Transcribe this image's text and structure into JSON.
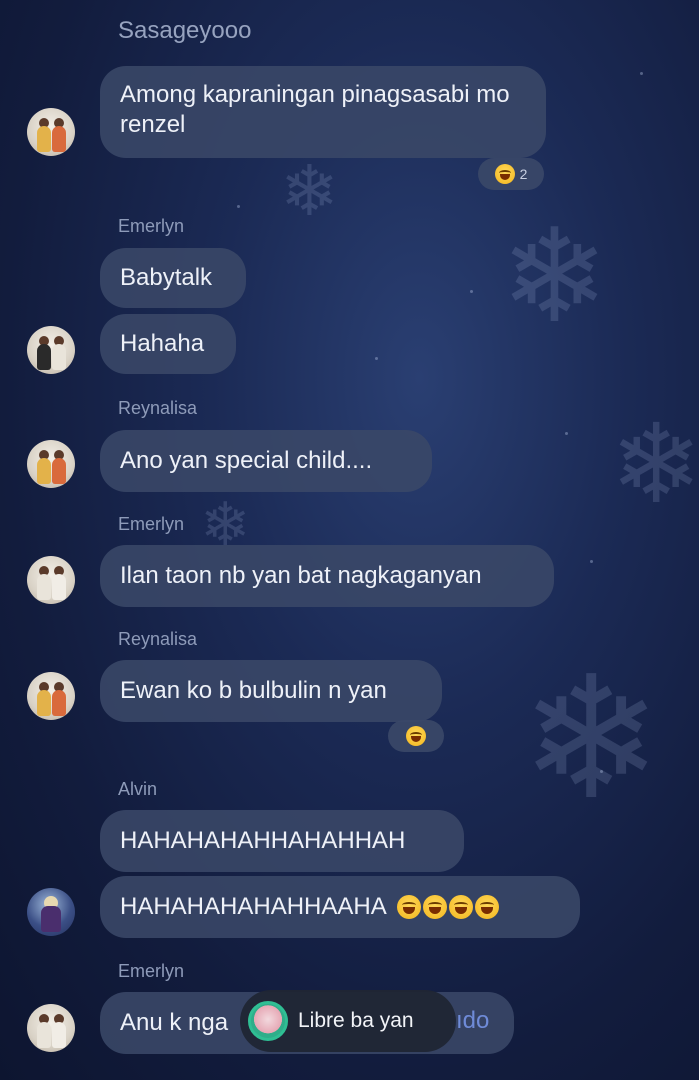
{
  "messages": [
    {
      "sender": "Sasageyooo",
      "lines": [
        "Among kapraningan pinagsasabi mo renzel"
      ],
      "reaction": {
        "count": "2"
      }
    },
    {
      "sender": "Emerlyn",
      "lines": [
        "Babytalk",
        "Hahaha"
      ]
    },
    {
      "sender": "Reynalisa",
      "lines": [
        "Ano yan special child...."
      ]
    },
    {
      "sender": "Emerlyn",
      "lines": [
        "Ilan taon nb yan bat nagkaganyan"
      ]
    },
    {
      "sender": "Reynalisa",
      "lines": [
        "Ewan ko b bulbulin n yan"
      ]
    },
    {
      "sender": "Alvin",
      "lines": [
        "HAHAHAHAHHAHAHHAH",
        "HAHAHAHAHAHHAAHA"
      ]
    },
    {
      "sender": "Emerlyn",
      "lines": [
        "Anu k nga"
      ],
      "hidden_tail": "ıdo"
    }
  ],
  "toast": {
    "text": "Libre ba yan"
  },
  "icons": {
    "reaction": "laughing-emoji-icon",
    "avatar": "profile-avatar-icon"
  },
  "colors": {
    "background": "#1b2a55",
    "bubble": "#3a4868",
    "sender": "#8e9bb9",
    "text": "#eef1f8"
  }
}
